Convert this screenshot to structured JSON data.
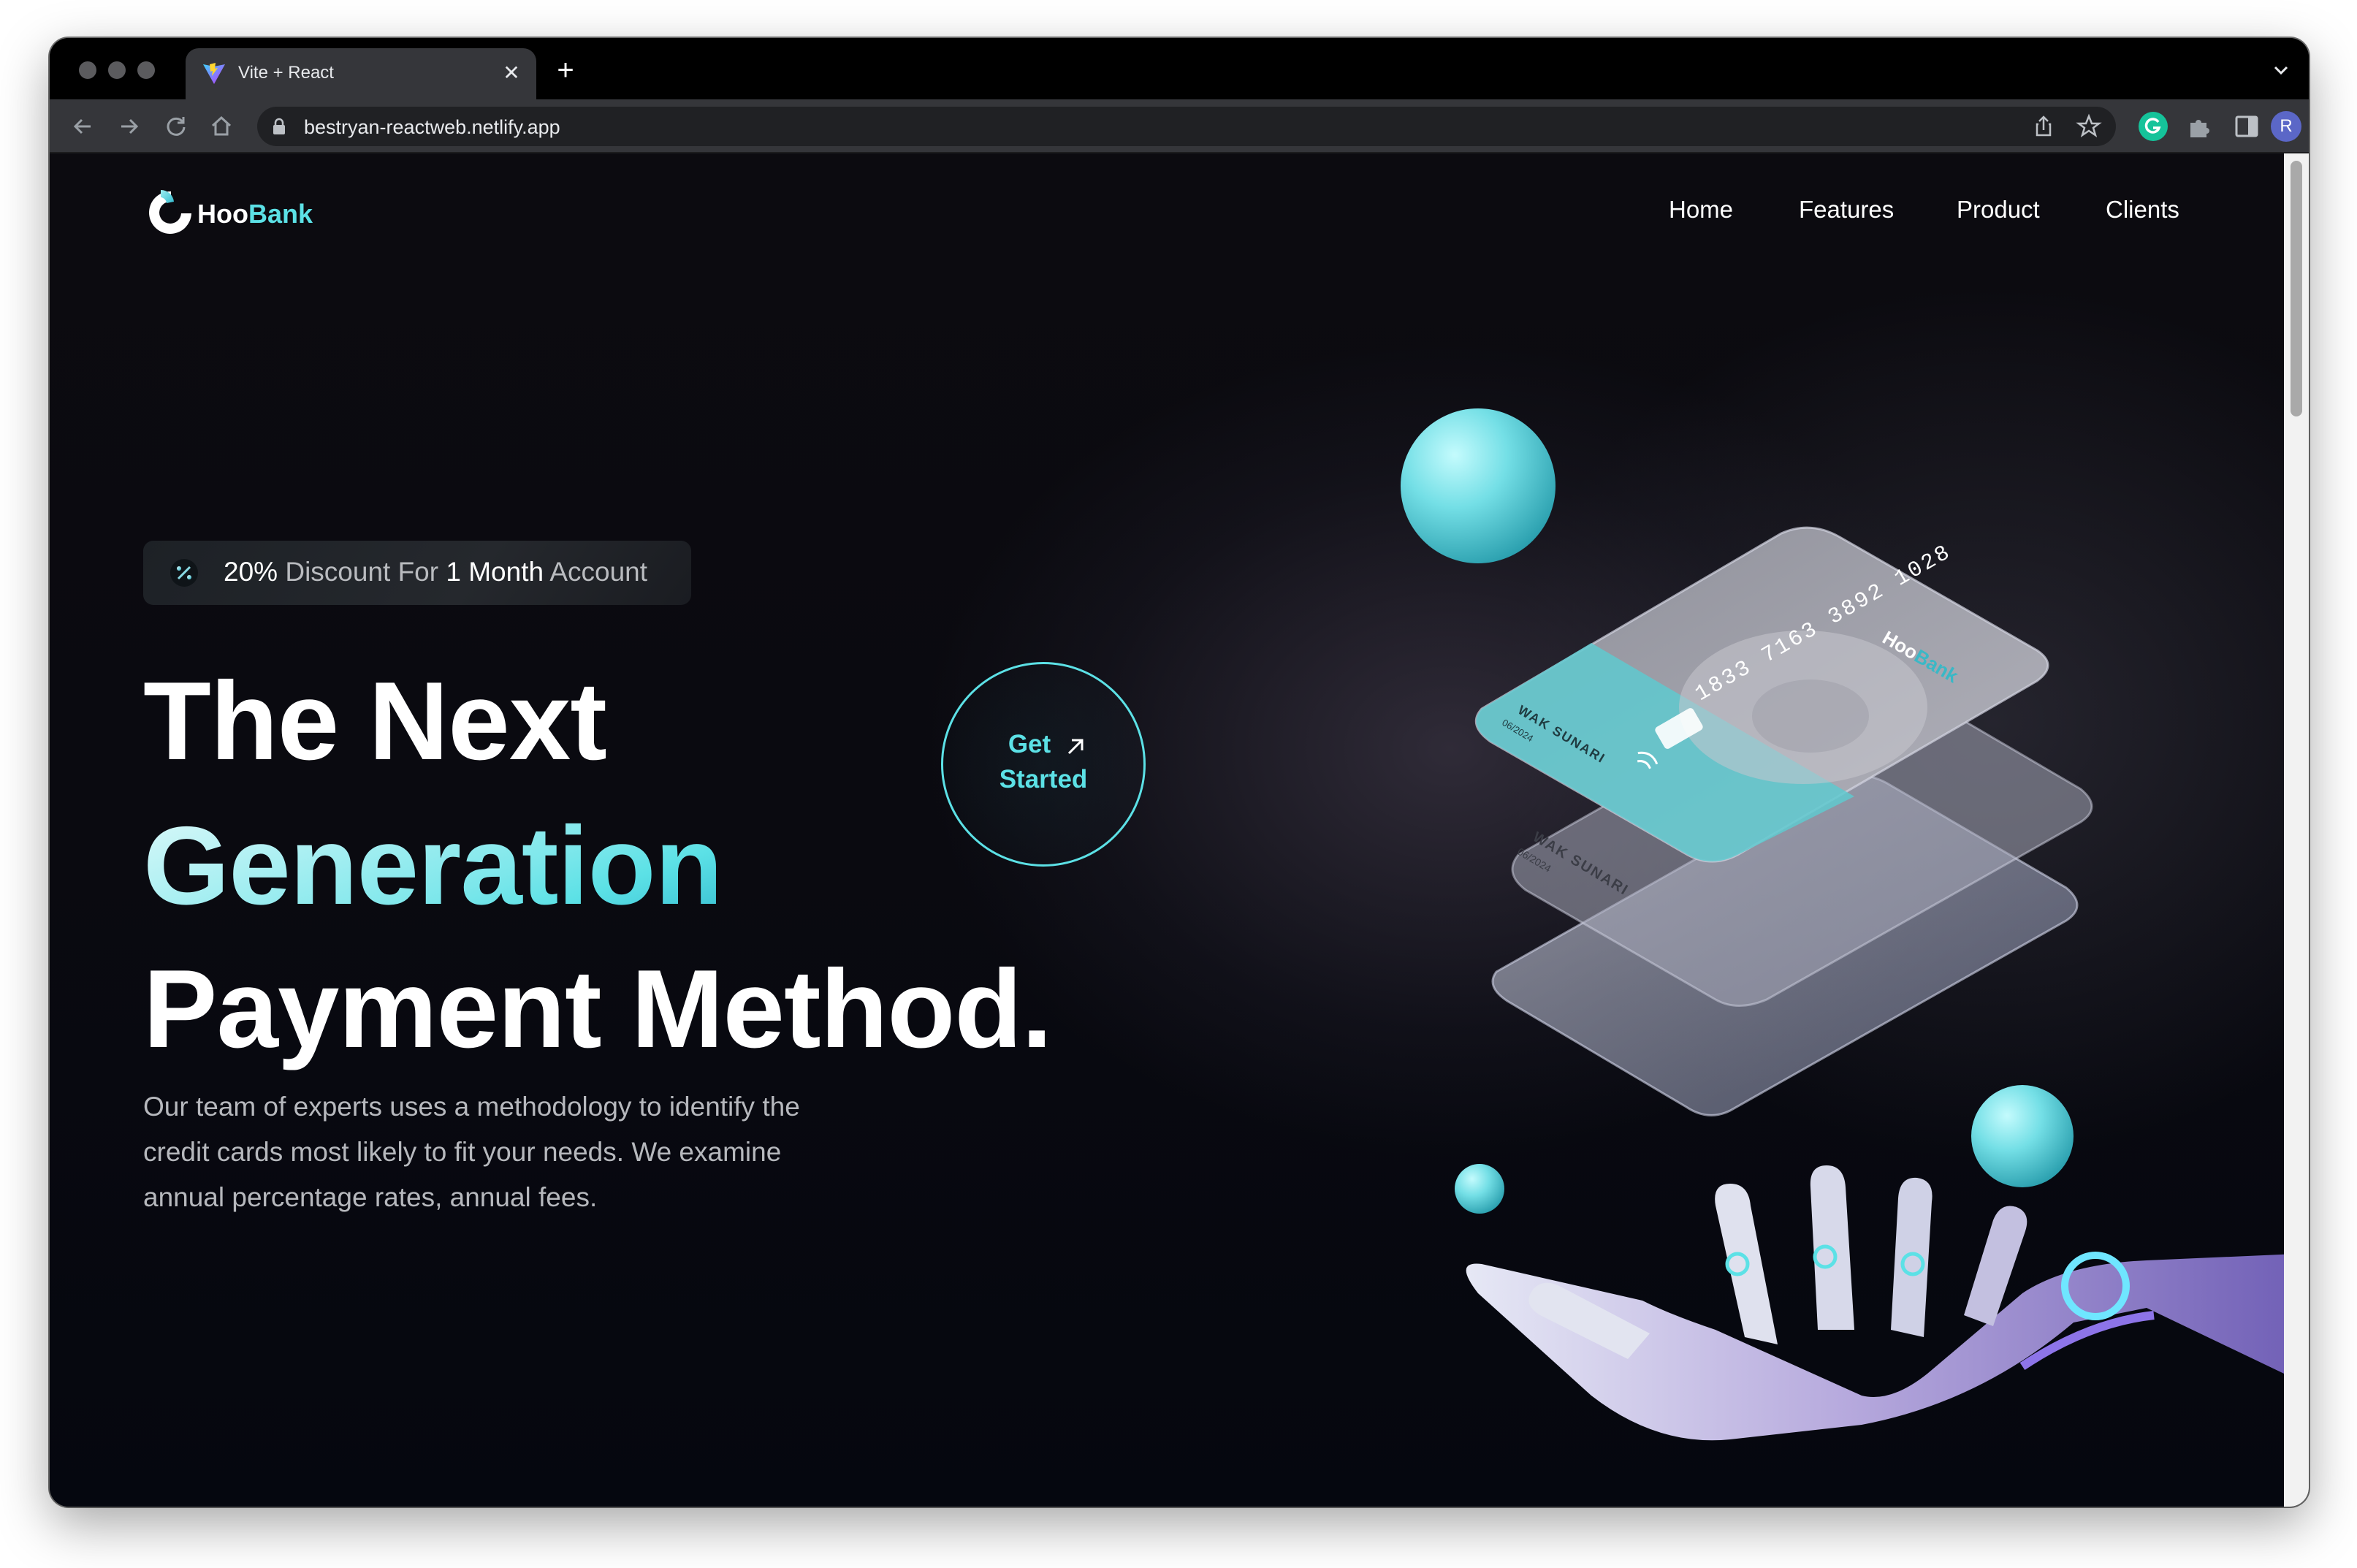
{
  "browser": {
    "tab_title": "Vite + React",
    "tab_close": "✕",
    "new_tab": "+",
    "url": "bestryan-reactweb.netlify.app",
    "profile_initial": "R"
  },
  "site": {
    "logo_prefix": "Hoo",
    "logo_accent": "Bank",
    "nav": [
      "Home",
      "Features",
      "Product",
      "Clients"
    ]
  },
  "hero": {
    "badge": {
      "pct": "20%",
      "text1": "Discount For",
      "num": "1",
      "month": "Month",
      "text2": "Account"
    },
    "line1": "The Next",
    "line2": "Generation",
    "line3": "Payment Method.",
    "description": "Our team of experts uses a methodology to identify the credit cards most likely to fit your needs. We examine annual percentage rates, annual fees.",
    "cta_line1": "Get",
    "cta_line2": "Started"
  },
  "card": {
    "number": "1833 7163 3892 1028",
    "brand_prefix": "Hoo",
    "brand_accent": "Bank",
    "holder": "WAK SUNARI",
    "expiry": "06/2024"
  },
  "colors": {
    "accent": "#5ce1e6",
    "background": "#0a0a10"
  }
}
